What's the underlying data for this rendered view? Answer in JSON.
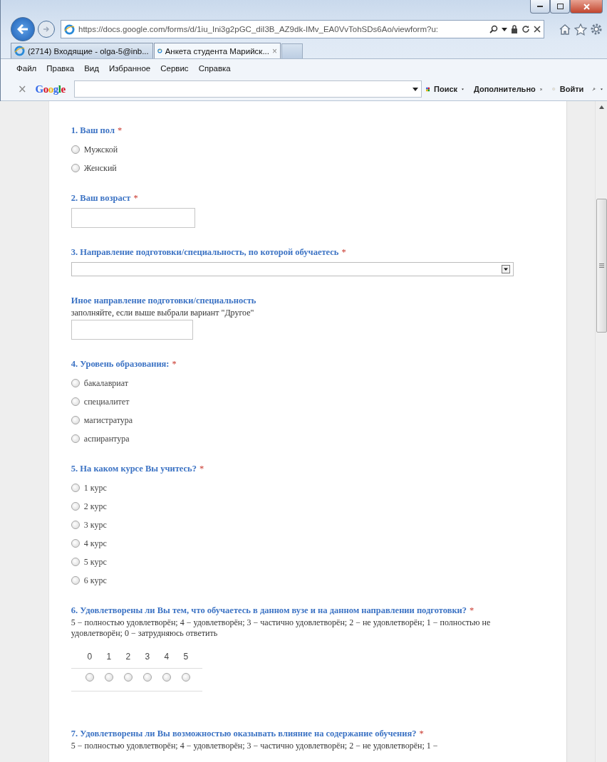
{
  "browser": {
    "url": "https://docs.google.com/forms/d/1iu_Ini3g2pGC_diI3B_AZ9dk-IMv_EA0VvTohSDs6Ao/viewform?u:",
    "tabs": [
      {
        "label": "(2714) Входящие - olga-5@inb...",
        "selected": false
      },
      {
        "label": "Анкета студента Марийск...",
        "selected": true,
        "close": "×"
      }
    ],
    "menu": [
      "Файл",
      "Правка",
      "Вид",
      "Избранное",
      "Сервис",
      "Справка"
    ],
    "toolbar": {
      "close": "×",
      "logo": "Google",
      "search": "Поиск",
      "more": "Дополнительно",
      "sign_in": "Войти"
    }
  },
  "form": {
    "questions": [
      {
        "kind": "radio",
        "title": "1. Ваш пол",
        "mark": "*",
        "options": [
          {
            "label": "Мужской",
            "selected": false
          },
          {
            "label": "Женский",
            "selected": false
          }
        ]
      },
      {
        "kind": "text",
        "title": "2. Ваш возраст",
        "mark": "*"
      },
      {
        "kind": "select",
        "title": "3. Направление подготовки/специальность, по которой обучаетесь",
        "mark": "*"
      },
      {
        "kind": "text",
        "title": "Иное направление подготовки/специальность",
        "help": "заполняйте, если выше выбрали вариант \"Другое\""
      },
      {
        "kind": "radio",
        "title": "4. Уровень образования:",
        "mark": "*",
        "options": [
          {
            "label": "бакалавриат",
            "selected": false
          },
          {
            "label": "специалитет",
            "selected": false
          },
          {
            "label": "магистратура",
            "selected": false
          },
          {
            "label": "аспирантура",
            "selected": false
          }
        ]
      },
      {
        "kind": "radio",
        "title": "5. На каком курсе Вы учитесь?",
        "mark": "*",
        "options": [
          {
            "label": "1 курс",
            "selected": false
          },
          {
            "label": "2 курс",
            "selected": false
          },
          {
            "label": "3 курс",
            "selected": false
          },
          {
            "label": "4 курс",
            "selected": false
          },
          {
            "label": "5 курс",
            "selected": false
          },
          {
            "label": "6 курс",
            "selected": false
          }
        ]
      },
      {
        "kind": "scale",
        "title": "6. Удовлетворены ли Вы тем, что обучаетесь в данном вузе и на данном направлении подготовки?",
        "mark": "*",
        "help": "5 − полностью удовлетворён; 4 − удовлетворён; 3 − частично удовлетворён; 2 − не удовлетворён; 1 − полностью не удовлетворён; 0 − затрудняюсь ответить",
        "scale": [
          {
            "label": "0",
            "selected": false
          },
          {
            "label": "1",
            "selected": false
          },
          {
            "label": "2",
            "selected": false
          },
          {
            "label": "3",
            "selected": false
          },
          {
            "label": "4",
            "selected": false
          },
          {
            "label": "5",
            "selected": false
          }
        ]
      },
      {
        "kind": "scale",
        "title": "7. Удовлетворены ли Вы возможностью оказывать влияние на содержание обучения?",
        "mark": "*",
        "help": "5 − полностью удовлетворён; 4 − удовлетворён; 3 − частично удовлетворён; 2 − не удовлетворён; 1 −"
      }
    ]
  }
}
